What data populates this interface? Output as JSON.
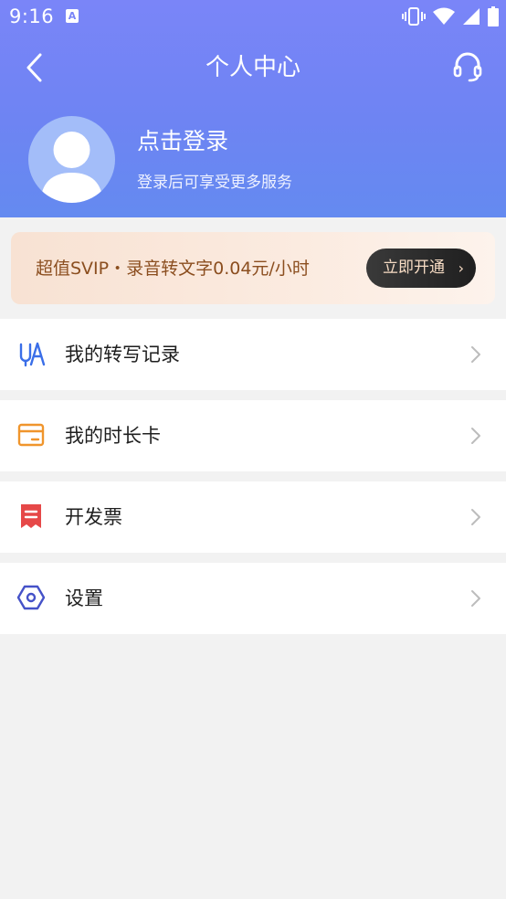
{
  "status_bar": {
    "time": "9:16",
    "notification_icon": "a-icon",
    "icons": [
      "vibrate-icon",
      "wifi-icon",
      "signal-icon",
      "battery-icon"
    ]
  },
  "nav": {
    "title": "个人中心",
    "back_icon": "chevron-left-icon",
    "service_icon": "headset-icon"
  },
  "profile": {
    "avatar_icon": "avatar-icon",
    "title": "点击登录",
    "subtitle": "登录后可享受更多服务"
  },
  "vip": {
    "text": "超值SVIP・录音转文字0.04元/小时",
    "button_label": "立即开通",
    "button_chevron": "›"
  },
  "menu": [
    {
      "label": "我的转写记录",
      "icon": "transcript-icon",
      "color": "#3a6ee8"
    },
    {
      "label": "我的时长卡",
      "icon": "card-icon",
      "color": "#f0952c"
    },
    {
      "label": "开发票",
      "icon": "invoice-icon",
      "color": "#e64848"
    },
    {
      "label": "设置",
      "icon": "settings-icon",
      "color": "#4552c8"
    }
  ],
  "colors": {
    "header_gradient_start": "#7a85f8",
    "header_gradient_end": "#648af0",
    "vip_text": "#8b4e1f",
    "page_background": "#f2f2f2"
  }
}
